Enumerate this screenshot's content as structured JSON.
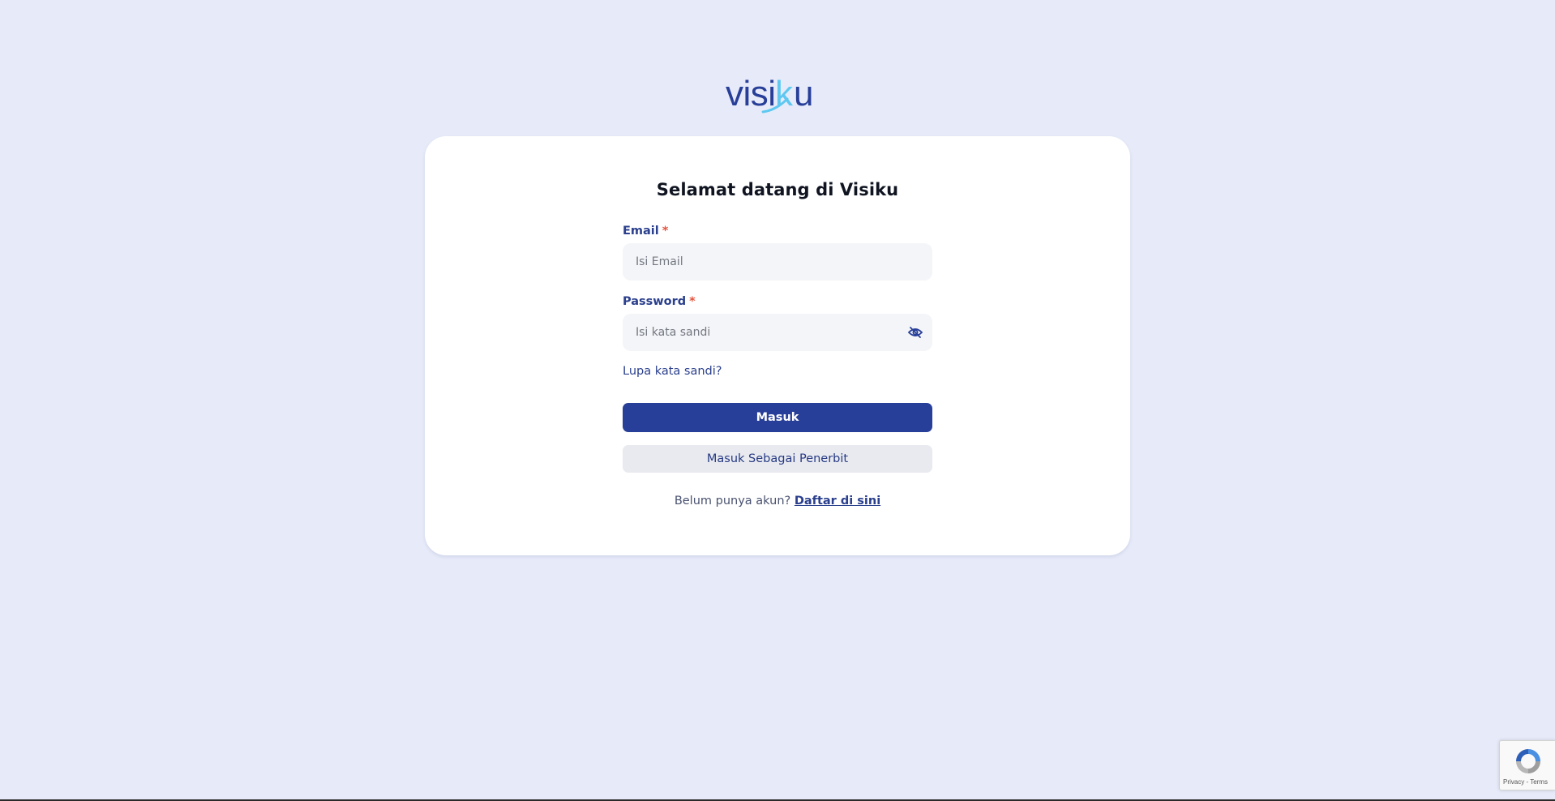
{
  "brand": {
    "logo_text": "visiku",
    "colors": {
      "primary": "#283f99",
      "accent": "#5ec8f0",
      "background": "#e7ebf9",
      "required": "#e5533d"
    }
  },
  "login": {
    "title": "Selamat datang di Visiku",
    "email": {
      "label": "Email",
      "required_mark": "*",
      "placeholder": "Isi Email",
      "value": ""
    },
    "password": {
      "label": "Password",
      "required_mark": "*",
      "placeholder": "Isi kata sandi",
      "value": "",
      "toggle_icon": "eye-off-icon"
    },
    "forgot_link": "Lupa kata sandi?",
    "submit_label": "Masuk",
    "publisher_label": "Masuk Sebagai Penerbit",
    "signup_prompt": "Belum punya akun?",
    "signup_link": "Daftar di sini"
  },
  "recaptcha": {
    "links": "Privacy - Terms",
    "icon": "recaptcha-icon"
  }
}
